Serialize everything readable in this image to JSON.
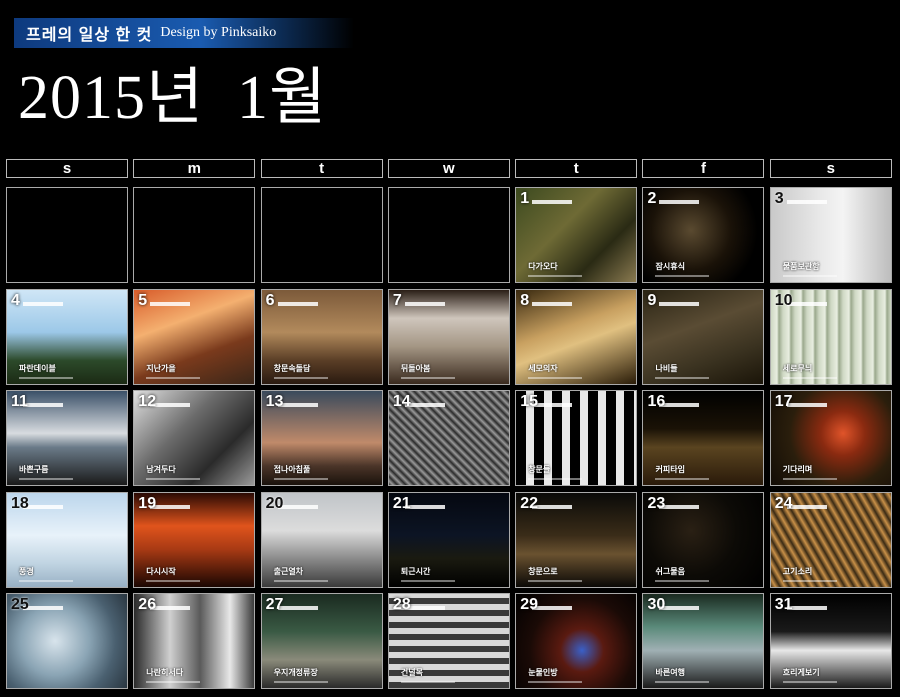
{
  "header": {
    "title": "프레의 일상 한 컷",
    "subtitle": "Design by Pinksaiko",
    "month_title": "2015년  1월"
  },
  "weekdays": [
    "s",
    "m",
    "t",
    "w",
    "t",
    "f",
    "s"
  ],
  "days": [
    {
      "day": "",
      "caption": "",
      "bg": "#000"
    },
    {
      "day": "",
      "caption": "",
      "bg": "#000"
    },
    {
      "day": "",
      "caption": "",
      "bg": "#000"
    },
    {
      "day": "",
      "caption": "",
      "bg": "#000"
    },
    {
      "day": "1",
      "caption": "다가오다",
      "bg": "linear-gradient(135deg,#3c4a1f 0%,#6e6a35 40%,#2a2a14 70%,#8a7a50 100%)"
    },
    {
      "day": "2",
      "caption": "잠시휴식",
      "bg": "radial-gradient(circle at 40% 45%,#5a4a30 0%,#1a1208 45%,#000 75%)"
    },
    {
      "day": "3",
      "caption": "물품보관함",
      "bg": "linear-gradient(90deg,#c9c9c9 0%,#e8e8e8 40%,#f4f4f4 60%,#bdbdbd 100%)"
    },
    {
      "day": "4",
      "caption": "파란데이블",
      "bg": "linear-gradient(180deg,#cfe6f6 0%,#9cc8e8 45%,#2c4a2a 75%,#1b2a14 100%)"
    },
    {
      "day": "5",
      "caption": "지난가을",
      "bg": "linear-gradient(160deg,#d85c2a 0%,#f4b070 35%,#7a3a1c 65%,#3a2618 100%)"
    },
    {
      "day": "6",
      "caption": "창문속돌담",
      "bg": "linear-gradient(180deg,#7c5a3a 0%,#b28a5c 45%,#5a3e26 75%,#2a1a10 100%)"
    },
    {
      "day": "7",
      "caption": "뒤돌아봄",
      "bg": "linear-gradient(180deg,#2a1e16 0%,#cfc6bc 30%,#a49684 60%,#3a2a1e 100%)"
    },
    {
      "day": "8",
      "caption": "세모의자",
      "bg": "linear-gradient(160deg,#3a2a10 0%,#c8a060 40%,#e0c080 55%,#2a1c08 100%)"
    },
    {
      "day": "9",
      "caption": "나비들",
      "bg": "linear-gradient(160deg,#2a2414 0%,#5a4c34 40%,#3a3220 70%,#1a1408 100%)"
    },
    {
      "day": "10",
      "caption": "세로무늬",
      "bg": "repeating-linear-gradient(90deg,#cfd8c4 0px,#e8eee0 6px,#9aa88c 8px,#cfd8c4 12px)"
    },
    {
      "day": "11",
      "caption": "바쁜구름",
      "bg": "linear-gradient(180deg,#3a5068 0%,#d8dce0 45%,#6a7a88 60%,#1a1a1a 100%)"
    },
    {
      "day": "12",
      "caption": "남겨두다",
      "bg": "linear-gradient(135deg,#e0e0e0 0%,#6a6a6a 40%,#2a2a2a 70%,#9a9a9a 100%)"
    },
    {
      "day": "13",
      "caption": "접나아침풀",
      "bg": "linear-gradient(180deg,#3a4a5c 0%,#c08a6a 55%,#4a3428 80%,#1a120c 100%)"
    },
    {
      "day": "14",
      "caption": "",
      "bg": "repeating-linear-gradient(45deg,#2a2a2a 0px,#9a9a9a 3px,#2a2a2a 6px)"
    },
    {
      "day": "15",
      "caption": "창문들",
      "bg": "repeating-linear-gradient(90deg,#000 0px,#000 10px,#e8e8e8 10px,#e8e8e8 18px)"
    },
    {
      "day": "16",
      "caption": "커피타임",
      "bg": "linear-gradient(180deg,#000 0%,#1a1206 40%,#5a4420 60%,#2a1a0a 100%)"
    },
    {
      "day": "17",
      "caption": "기다리며",
      "bg": "radial-gradient(circle at 60% 45%,#e0542a 0%,#8a2a10 25%,#2a1e0c 60%,#120c06 100%)"
    },
    {
      "day": "18",
      "caption": "풍경",
      "bg": "linear-gradient(180deg,#bcd6ec 0%,#e8f2fa 45%,#c0d4e2 75%,#98b0c4 100%)"
    },
    {
      "day": "19",
      "caption": "다시시작",
      "bg": "linear-gradient(180deg,#2a0a04 0%,#e0541c 35%,#a83a14 60%,#1a0602 100%)"
    },
    {
      "day": "20",
      "caption": "출근열차",
      "bg": "linear-gradient(180deg,#c0c4c8 0%,#dcdcdc 40%,#8a8a8a 70%,#3a3a3a 100%)"
    },
    {
      "day": "21",
      "caption": "퇴근시간",
      "bg": "linear-gradient(180deg,#050810 0%,#0c1424 45%,#1a1a10 70%,#000 100%)"
    },
    {
      "day": "22",
      "caption": "창문으로",
      "bg": "linear-gradient(180deg,#0a0a08 0%,#3a2c18 45%,#6a5230 65%,#0a0806 100%)"
    },
    {
      "day": "23",
      "caption": "쉬그물음",
      "bg": "radial-gradient(circle at 40% 40%,#2a2014 0%,#0c0a06 50%,#000 100%)"
    },
    {
      "day": "24",
      "caption": "고기소리",
      "bg": "repeating-linear-gradient(60deg,#3a2a14 0px,#c89048 4px,#3a2a14 8px)"
    },
    {
      "day": "25",
      "caption": "",
      "bg": "radial-gradient(circle at 40% 50%,#d8e4ec 0%,#8aa4b4 40%,#4a6070 70%,#2a3640 100%)"
    },
    {
      "day": "26",
      "caption": "나란히서다",
      "bg": "linear-gradient(90deg,#2a2a2a 0%,#d0d0d0 30%,#5a5a5a 55%,#e8e8e8 80%,#3a3a3a 100%)"
    },
    {
      "day": "27",
      "caption": "우지개정류장",
      "bg": "linear-gradient(180deg,#1a2a20 0%,#3a5a44 40%,#8a8a7a 70%,#2a2a2a 100%)"
    },
    {
      "day": "28",
      "caption": "건널목",
      "bg": "repeating-linear-gradient(0deg,#3a3a3a 0px,#3a3a3a 6px,#d8d8d8 6px,#d8d8d8 12px)"
    },
    {
      "day": "29",
      "caption": "눈물인방",
      "bg": "radial-gradient(circle at 55% 60%,#3a60c8 0%,#5a1a10 25%,#1a0a06 60%,#000 100%)"
    },
    {
      "day": "30",
      "caption": "바른여행",
      "bg": "linear-gradient(180deg,#1a2a20 0%,#5a8a7a 35%,#a0b0b4 60%,#1a1a1a 100%)"
    },
    {
      "day": "31",
      "caption": "흐리게보기",
      "bg": "linear-gradient(180deg,#000 0%,#1a1a1a 40%,#e8e8e8 60%,#1a1a1a 100%)"
    }
  ]
}
